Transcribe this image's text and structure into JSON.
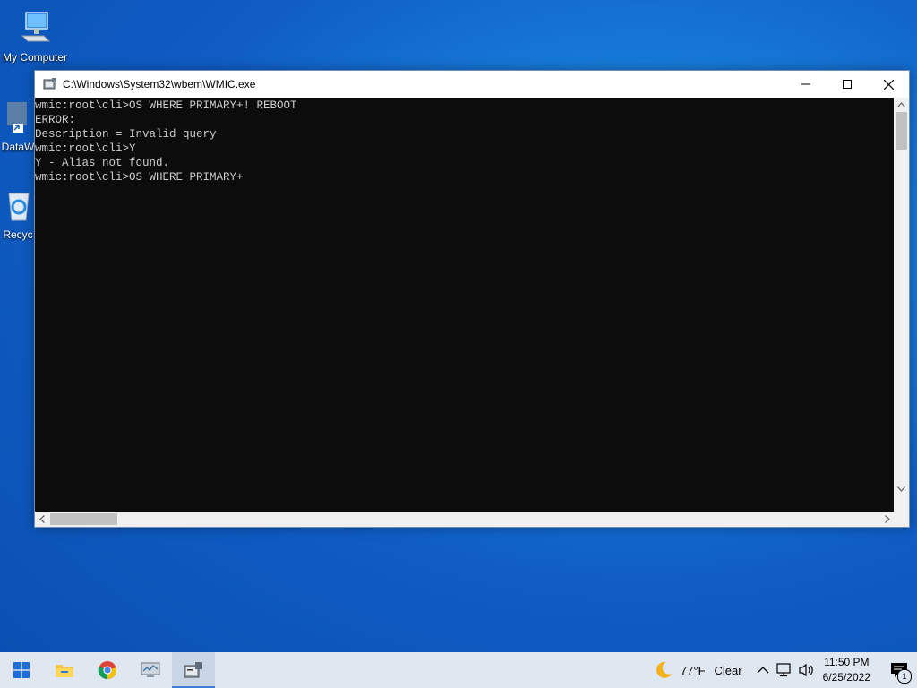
{
  "desktop": {
    "icons": [
      {
        "label": "My Computer"
      },
      {
        "label": "DataW"
      },
      {
        "label": "Recyc"
      }
    ]
  },
  "window": {
    "title": "C:\\Windows\\System32\\wbem\\WMIC.exe",
    "console_lines": [
      "wmic:root\\cli>OS WHERE PRIMARY+! REBOOT",
      "ERROR:",
      "Description = Invalid query",
      "wmic:root\\cli>Y",
      "Y - Alias not found.",
      "wmic:root\\cli>OS WHERE PRIMARY+"
    ]
  },
  "taskbar": {
    "weather_temp": "77°F",
    "weather_desc": "Clear",
    "time": "11:50 PM",
    "date": "6/25/2022",
    "notification_count": "1"
  },
  "colors": {
    "console_bg": "#0c0c0c",
    "console_fg": "#cccccc",
    "accent": "#3f7ed8"
  }
}
